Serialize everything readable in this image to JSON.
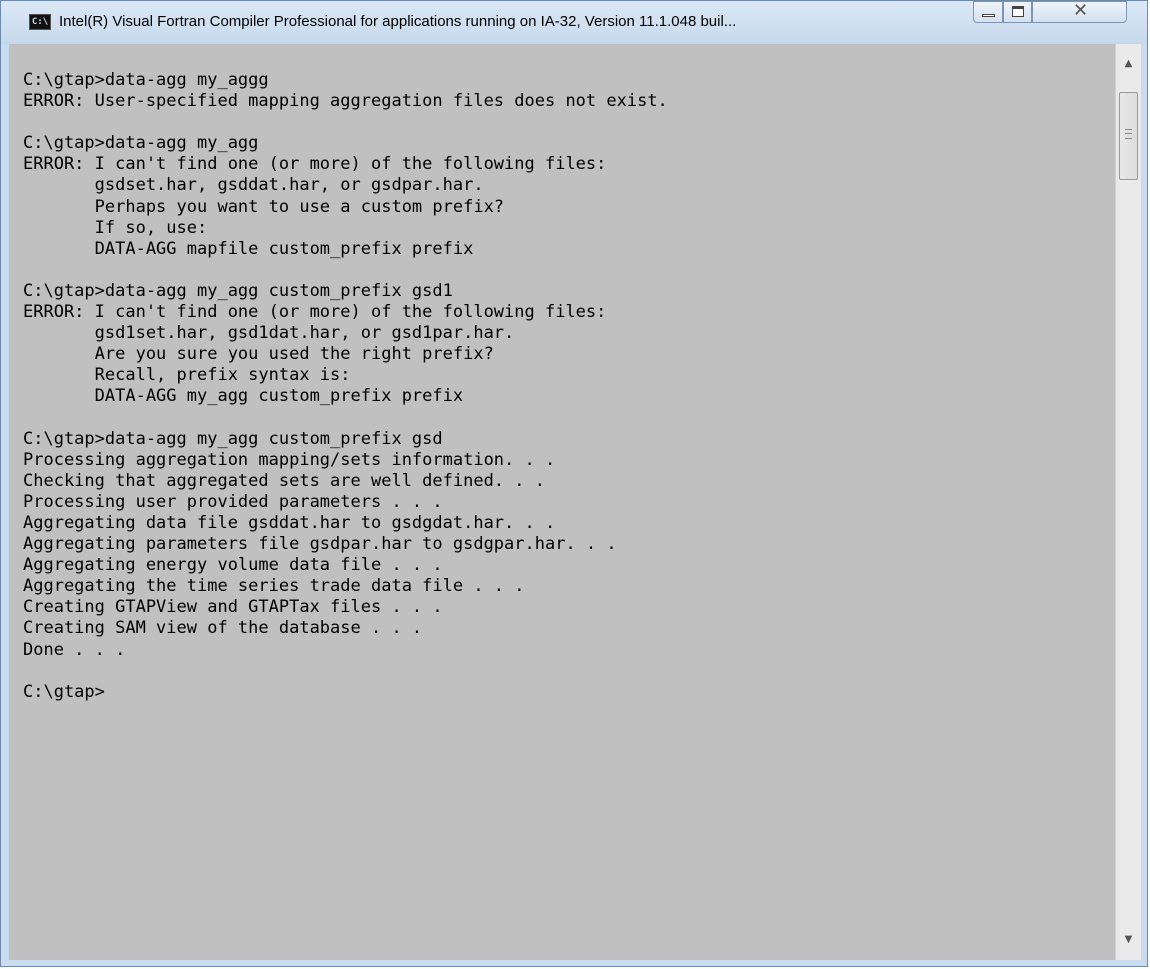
{
  "window": {
    "icon_text": "C:\\",
    "title": "Intel(R) Visual Fortran Compiler Professional for applications running on IA-32, Version 11.1.048 buil..."
  },
  "icons": {
    "app": "console-window-icon",
    "minimize": "minimize-icon",
    "maximize": "maximize-icon",
    "close": "close-icon",
    "scroll_up": "scroll-up-arrow-icon",
    "scroll_down": "scroll-down-arrow-icon"
  },
  "colors": {
    "console_background": "#c0c0c0",
    "console_text": "#000000",
    "titlebar": "#c9dcef"
  },
  "console": {
    "lines": [
      "C:\\gtap>data-agg my_aggg",
      "ERROR: User-specified mapping aggregation files does not exist.",
      "",
      "C:\\gtap>data-agg my_agg",
      "ERROR: I can't find one (or more) of the following files:",
      "       gsdset.har, gsddat.har, or gsdpar.har.",
      "       Perhaps you want to use a custom prefix?",
      "       If so, use:",
      "       DATA-AGG mapfile custom_prefix prefix",
      "",
      "C:\\gtap>data-agg my_agg custom_prefix gsd1",
      "ERROR: I can't find one (or more) of the following files:",
      "       gsd1set.har, gsd1dat.har, or gsd1par.har.",
      "       Are you sure you used the right prefix?",
      "       Recall, prefix syntax is:",
      "       DATA-AGG my_agg custom_prefix prefix",
      "",
      "C:\\gtap>data-agg my_agg custom_prefix gsd",
      "Processing aggregation mapping/sets information. . .",
      "Checking that aggregated sets are well defined. . .",
      "Processing user provided parameters . . .",
      "Aggregating data file gsddat.har to gsdgdat.har. . .",
      "Aggregating parameters file gsdpar.har to gsdgpar.har. . .",
      "Aggregating energy volume data file . . .",
      "Aggregating the time series trade data file . . .",
      "Creating GTAPView and GTAPTax files . . .",
      "Creating SAM view of the database . . .",
      "Done . . .",
      "",
      "C:\\gtap>"
    ]
  }
}
